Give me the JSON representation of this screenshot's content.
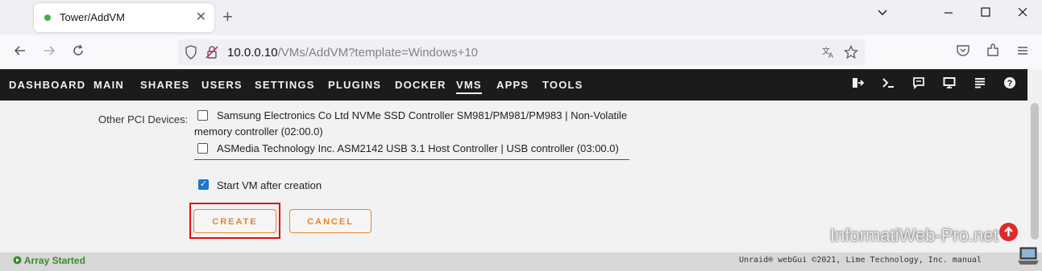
{
  "browser": {
    "tab_title": "Tower/AddVM",
    "tab_close": "✕",
    "new_tab": "+",
    "url_host": "10.0.0.10",
    "url_rest": "/VMs/AddVM?template=Windows+10"
  },
  "menu": {
    "items": [
      "DASHBOARD",
      "MAIN",
      "SHARES",
      "USERS",
      "SETTINGS",
      "PLUGINS",
      "DOCKER",
      "VMS",
      "APPS",
      "TOOLS"
    ],
    "active": "VMS"
  },
  "form": {
    "pci_label": "Other PCI Devices:",
    "pci_devices": [
      {
        "line1": "Samsung Electronics Co Ltd NVMe SSD Controller SM981/PM981/PM983 | Non-Volatile",
        "line2": "memory controller (02:00.0)",
        "checked": false
      },
      {
        "line1": "ASMedia Technology Inc. ASM2142 USB 3.1 Host Controller | USB controller (03:00.0)",
        "checked": false
      }
    ],
    "start_vm_label": "Start VM after creation",
    "start_vm_checked": true,
    "create_label": "CREATE",
    "cancel_label": "CANCEL"
  },
  "footer": {
    "status": "Array Started",
    "copyright": "Unraid® webGui ©2021, Lime Technology, Inc. manual"
  },
  "watermark": "InformatiWeb-Pro.net",
  "colors": {
    "accent": "#e98526",
    "menu_bg": "#1c1b1b",
    "status_green": "#3c8b2a",
    "highlight_red": "#e01010"
  }
}
